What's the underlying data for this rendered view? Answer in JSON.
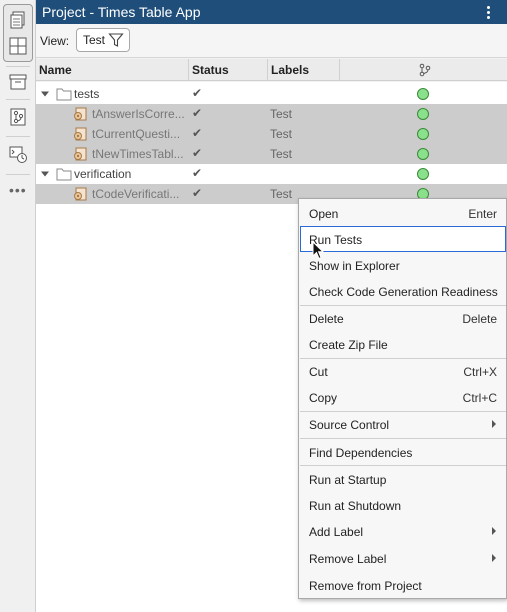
{
  "panel": {
    "title": "Project - Times Table App",
    "view_label": "View:",
    "view_value": "Test"
  },
  "columns": {
    "name": "Name",
    "status": "Status",
    "labels": "Labels"
  },
  "tree": {
    "rows": [
      {
        "name": "tests",
        "type": "folder",
        "status": "✔",
        "label": "",
        "selected": false
      },
      {
        "name": "tAnswerIsCorre...",
        "type": "file",
        "status": "✔",
        "label": "Test",
        "selected": true
      },
      {
        "name": "tCurrentQuesti...",
        "type": "file",
        "status": "✔",
        "label": "Test",
        "selected": true
      },
      {
        "name": "tNewTimesTabl...",
        "type": "file",
        "status": "✔",
        "label": "Test",
        "selected": true
      },
      {
        "name": "verification",
        "type": "folder",
        "status": "✔",
        "label": "",
        "selected": false
      },
      {
        "name": "tCodeVerificati...",
        "type": "file",
        "status": "✔",
        "label": "Test",
        "selected": true
      }
    ],
    "status_color": "#8be08b"
  },
  "context_menu": {
    "items": [
      {
        "label": "Open",
        "shortcut": "Enter"
      },
      {
        "label": "Run Tests",
        "shortcut": ""
      },
      {
        "label": "Show in Explorer",
        "shortcut": ""
      },
      {
        "label": "Check Code Generation Readiness",
        "shortcut": ""
      },
      {
        "label": "Delete",
        "shortcut": "Delete"
      },
      {
        "label": "Create Zip File",
        "shortcut": ""
      },
      {
        "label": "Cut",
        "shortcut": "Ctrl+X"
      },
      {
        "label": "Copy",
        "shortcut": "Ctrl+C"
      },
      {
        "label": "Source Control",
        "shortcut": ""
      },
      {
        "label": "Find Dependencies",
        "shortcut": ""
      },
      {
        "label": "Run at Startup",
        "shortcut": ""
      },
      {
        "label": "Run at Shutdown",
        "shortcut": ""
      },
      {
        "label": "Add Label",
        "shortcut": ""
      },
      {
        "label": "Remove Label",
        "shortcut": ""
      },
      {
        "label": "Remove from Project",
        "shortcut": ""
      }
    ],
    "hovered": "Run Tests",
    "accent": "#2a6ad6"
  },
  "theme": {
    "titlebar": "#1e4e79",
    "selection": "#cccccc"
  }
}
